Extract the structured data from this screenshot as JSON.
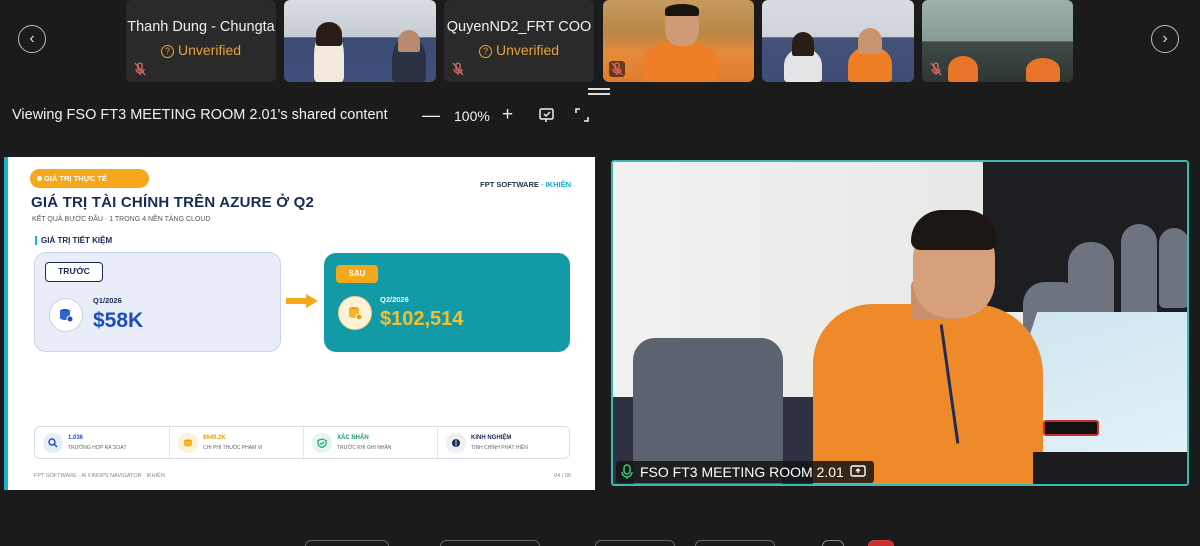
{
  "participants": [
    {
      "name": "Thanh Dung - Chungta",
      "status": "Unverified"
    },
    {
      "name": "QuyenND2_FRT COO",
      "status": "Unverified"
    }
  ],
  "toolbar": {
    "viewing_text": "Viewing FSO FT3 MEETING ROOM 2.01's shared content",
    "zoom_minus": "—",
    "zoom_level": "100%",
    "zoom_plus": "+"
  },
  "slide": {
    "chip": "GIÁ TRỊ THỰC TẾ",
    "brand_left": "FPT SOFTWARE",
    "brand_sep": "·",
    "brand_right": "IKHIÊN",
    "title": "GIÁ TRỊ TÀI CHÍNH TRÊN AZURE Ở Q2",
    "subtitle": "KẾT QUẢ BƯỚC ĐẦU · 1 TRONG 4 NỀN TẢNG CLOUD",
    "section_label": "GIÁ TRỊ TIẾT KIỆM",
    "before": {
      "tag": "TRƯỚC",
      "period": "Q1/2026",
      "value": "$58K"
    },
    "after": {
      "tag": "SAU",
      "period": "Q2/2026",
      "value": "$102,514"
    },
    "stats": [
      {
        "value": "1.036",
        "label": "TRƯỜNG HỢP RÀ SOÁT",
        "color": "#1d4fb8",
        "icon": "search-icon"
      },
      {
        "value": "$649.2K",
        "label": "CHI PHÍ THUỘC PHẠM VI",
        "color": "#e0a010",
        "icon": "coins-icon"
      },
      {
        "value": "XÁC NHẬN",
        "label": "TRƯỚC KHI GHI NHẬN",
        "color": "#17a06b",
        "icon": "shield-check-icon"
      },
      {
        "value": "KINH NGHIỆM",
        "label": "TINH CHỈNH PHÁT HIỆN",
        "color": "#182b55",
        "icon": "brain-icon"
      }
    ],
    "footer": "FPT SOFTWARE · AI FINOPS NAVIGATOR · IKHIÊN",
    "page": "04 / 06"
  },
  "video": {
    "room_label": "FSO FT3 MEETING ROOM 2.01"
  },
  "colors": {
    "accent_teal": "#139aa7",
    "accent_orange": "#f6a81c",
    "navy": "#182b55",
    "unverified": "#e8a33a",
    "active_border": "#3db7b2"
  }
}
